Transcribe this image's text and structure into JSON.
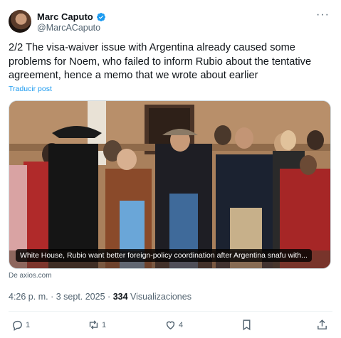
{
  "author": {
    "name": "Marc Caputo",
    "handle": "@MarcACaputo"
  },
  "tweet": {
    "text": "2/2 The visa-waiver issue with Argentina already caused some problems for Noem, who failed to inform Rubio about the tentative agreement, hence a memo that we wrote about earlier",
    "translate_label": "Traducir post"
  },
  "card": {
    "title": "White House, Rubio want better foreign-policy coordination after Argentina snafu with...",
    "source": "De axios.com"
  },
  "meta": {
    "time": "4:26 p. m.",
    "separator": "·",
    "date": "3 sept. 2025",
    "views_count": "334",
    "views_label": "Visualizaciones"
  },
  "actions": {
    "reply_count": "1",
    "repost_count": "1",
    "like_count": "4"
  },
  "colors": {
    "accent": "#1d9bf0",
    "text": "#0f1419",
    "secondary": "#536471"
  },
  "icons": [
    "verified-badge-icon",
    "more-icon",
    "reply-icon",
    "repost-icon",
    "like-icon",
    "bookmark-icon",
    "share-icon"
  ]
}
